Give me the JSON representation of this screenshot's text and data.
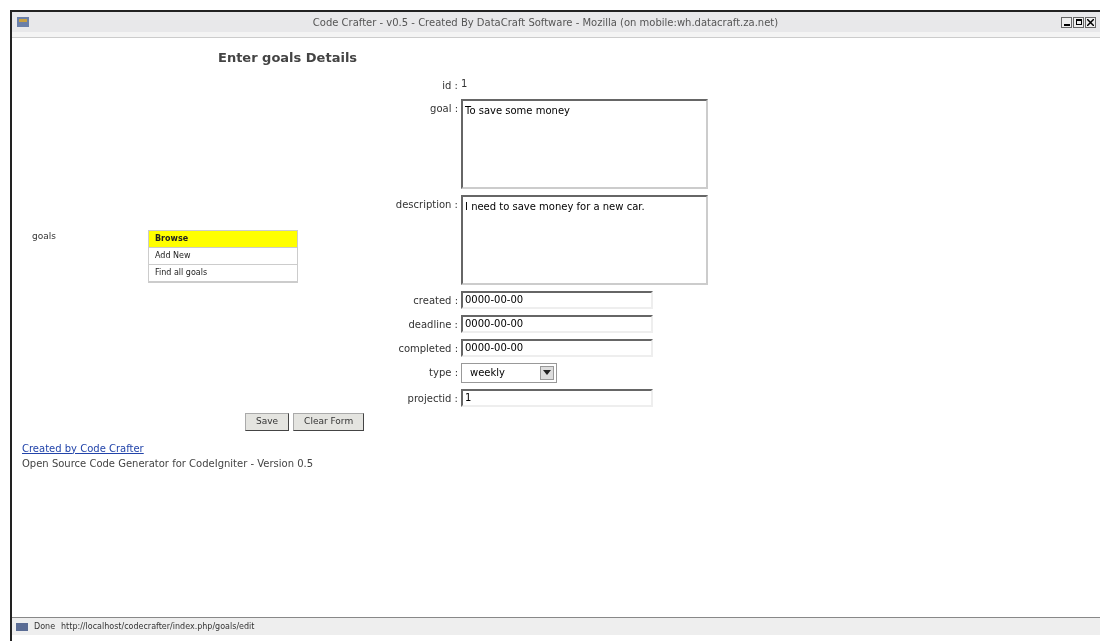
{
  "window": {
    "title": "Code Crafter - v0.5 - Created By DataCraft Software - Mozilla (on mobile:wh.datacraft.za.net)"
  },
  "heading": "Enter goals Details",
  "menu": {
    "label": "goals",
    "items": [
      {
        "label": "Browse",
        "selected": true
      },
      {
        "label": "Add New",
        "selected": false
      },
      {
        "label": "Find all goals",
        "selected": false
      }
    ]
  },
  "form": {
    "fields": [
      {
        "kind": "text",
        "label": "id :",
        "value": "1"
      },
      {
        "kind": "textarea",
        "label": "goal :",
        "value": "To save some money"
      },
      {
        "kind": "textarea",
        "label": "description :",
        "value": "I need to save money for a new car."
      },
      {
        "kind": "input",
        "label": "created :",
        "value": "0000-00-00"
      },
      {
        "kind": "input",
        "label": "deadline :",
        "value": "0000-00-00"
      },
      {
        "kind": "input",
        "label": "completed :",
        "value": "0000-00-00"
      },
      {
        "kind": "select",
        "label": "type :",
        "value": "weekly"
      },
      {
        "kind": "input",
        "label": "projectid :",
        "value": "1"
      }
    ],
    "buttons": [
      "Save",
      "Clear Form"
    ]
  },
  "footer": {
    "link": "Created by Code Crafter",
    "text": "Open Source Code Generator for CodeIgniter - Version 0.5"
  },
  "status_bar": {
    "text": "Done",
    "url": "http://localhost/codecrafter/index.php/goals/edit"
  }
}
